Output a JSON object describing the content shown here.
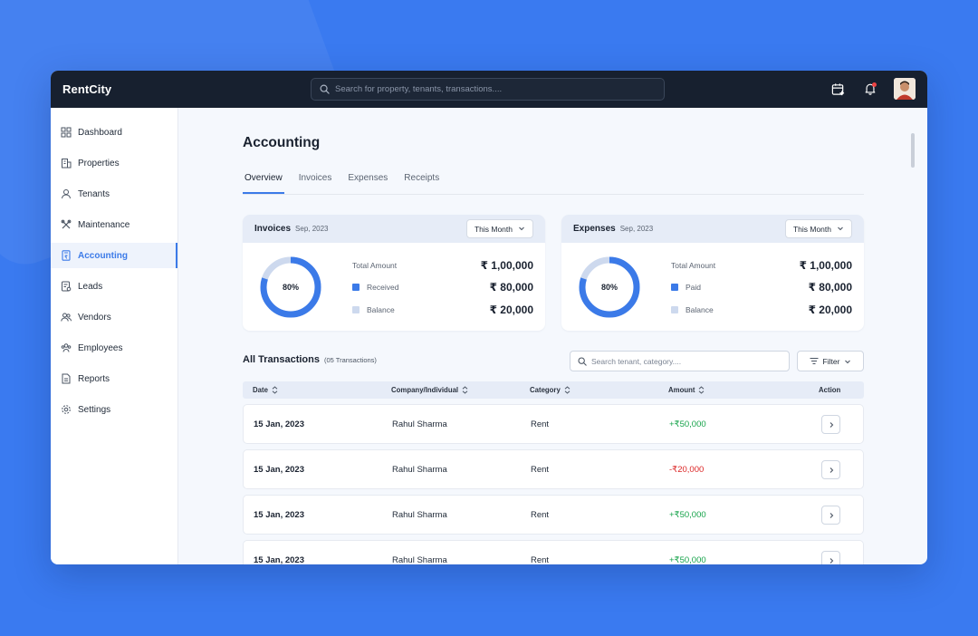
{
  "app": {
    "brand": "RentCity",
    "search_placeholder": "Search for property, tenants, transactions....",
    "icons": [
      "calendar-plus-icon",
      "bell-icon"
    ]
  },
  "sidebar": {
    "items": [
      {
        "label": "Dashboard",
        "icon": "dashboard-icon"
      },
      {
        "label": "Properties",
        "icon": "building-icon"
      },
      {
        "label": "Tenants",
        "icon": "user-icon"
      },
      {
        "label": "Maintenance",
        "icon": "tools-icon"
      },
      {
        "label": "Accounting",
        "icon": "calculator-icon",
        "active": true
      },
      {
        "label": "Leads",
        "icon": "leads-icon"
      },
      {
        "label": "Vendors",
        "icon": "vendors-icon"
      },
      {
        "label": "Employees",
        "icon": "employees-icon"
      },
      {
        "label": "Reports",
        "icon": "report-icon"
      },
      {
        "label": "Settings",
        "icon": "gear-icon"
      }
    ]
  },
  "page": {
    "title": "Accounting",
    "tabs": [
      "Overview",
      "Invoices",
      "Expenses",
      "Receipts"
    ],
    "active_tab": "Overview"
  },
  "cards": {
    "invoices": {
      "title": "Invoices",
      "period": "Sep, 2023",
      "select": "This Month",
      "percent_label": "80%",
      "percent": 0.8,
      "total_label": "Total Amount",
      "total": "₹ 1,00,000",
      "primary_label": "Received",
      "primary_value": "₹ 80,000",
      "secondary_label": "Balance",
      "secondary_value": "₹ 20,000"
    },
    "expenses": {
      "title": "Expenses",
      "period": "Sep, 2023",
      "select": "This Month",
      "percent_label": "80%",
      "percent": 0.8,
      "total_label": "Total Amount",
      "total": "₹ 1,00,000",
      "primary_label": "Paid",
      "primary_value": "₹ 80,000",
      "secondary_label": "Balance",
      "secondary_value": "₹ 20,000"
    }
  },
  "colors": {
    "accent": "#3b7ae8",
    "donut_track": "#cdd9ee",
    "positive": "#16a34a",
    "negative": "#dc2626"
  },
  "transactions": {
    "title": "All Transactions",
    "count": "(05 Transactions)",
    "search_placeholder": "Search tenant, category....",
    "filter_label": "Filter",
    "columns": [
      "Date",
      "Company/Individual",
      "Category",
      "Amount",
      "Action"
    ],
    "rows": [
      {
        "date": "15 Jan, 2023",
        "party": "Rahul Sharma",
        "category": "Rent",
        "amount": "+₹50,000"
      },
      {
        "date": "15 Jan, 2023",
        "party": "Rahul Sharma",
        "category": "Rent",
        "amount": "-₹20,000"
      },
      {
        "date": "15 Jan, 2023",
        "party": "Rahul Sharma",
        "category": "Rent",
        "amount": "+₹50,000"
      },
      {
        "date": "15 Jan, 2023",
        "party": "Rahul Sharma",
        "category": "Rent",
        "amount": "+₹50,000"
      }
    ]
  }
}
